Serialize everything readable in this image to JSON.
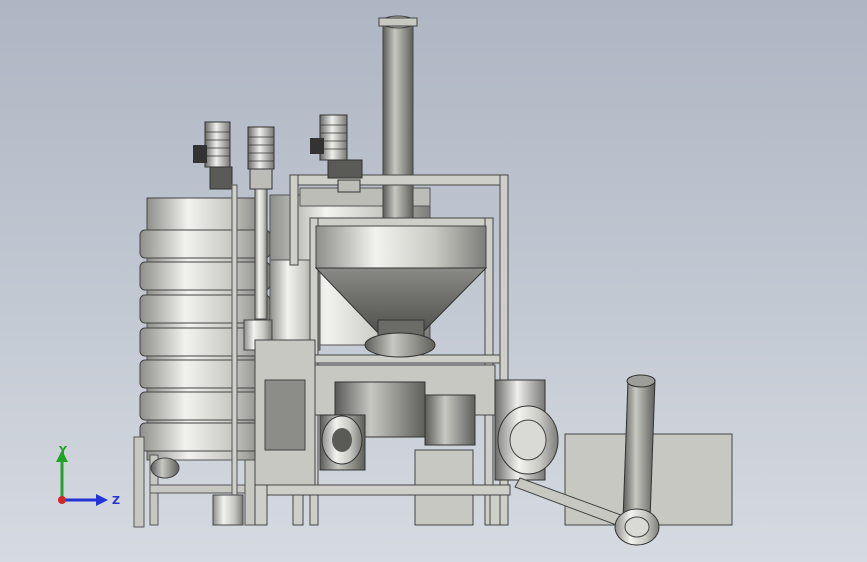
{
  "triad": {
    "y_label": "Y",
    "z_label": "Z",
    "colors": {
      "y": "#21a32a",
      "z": "#2433d6",
      "x": "#d42424"
    }
  },
  "model": {
    "colors": {
      "metal_light": "#e6e6e2",
      "metal_mid": "#b9b9b4",
      "metal_dark": "#6e6e6a",
      "frame": "#cfcfca",
      "motor_blue": "#dfe3e6"
    }
  }
}
